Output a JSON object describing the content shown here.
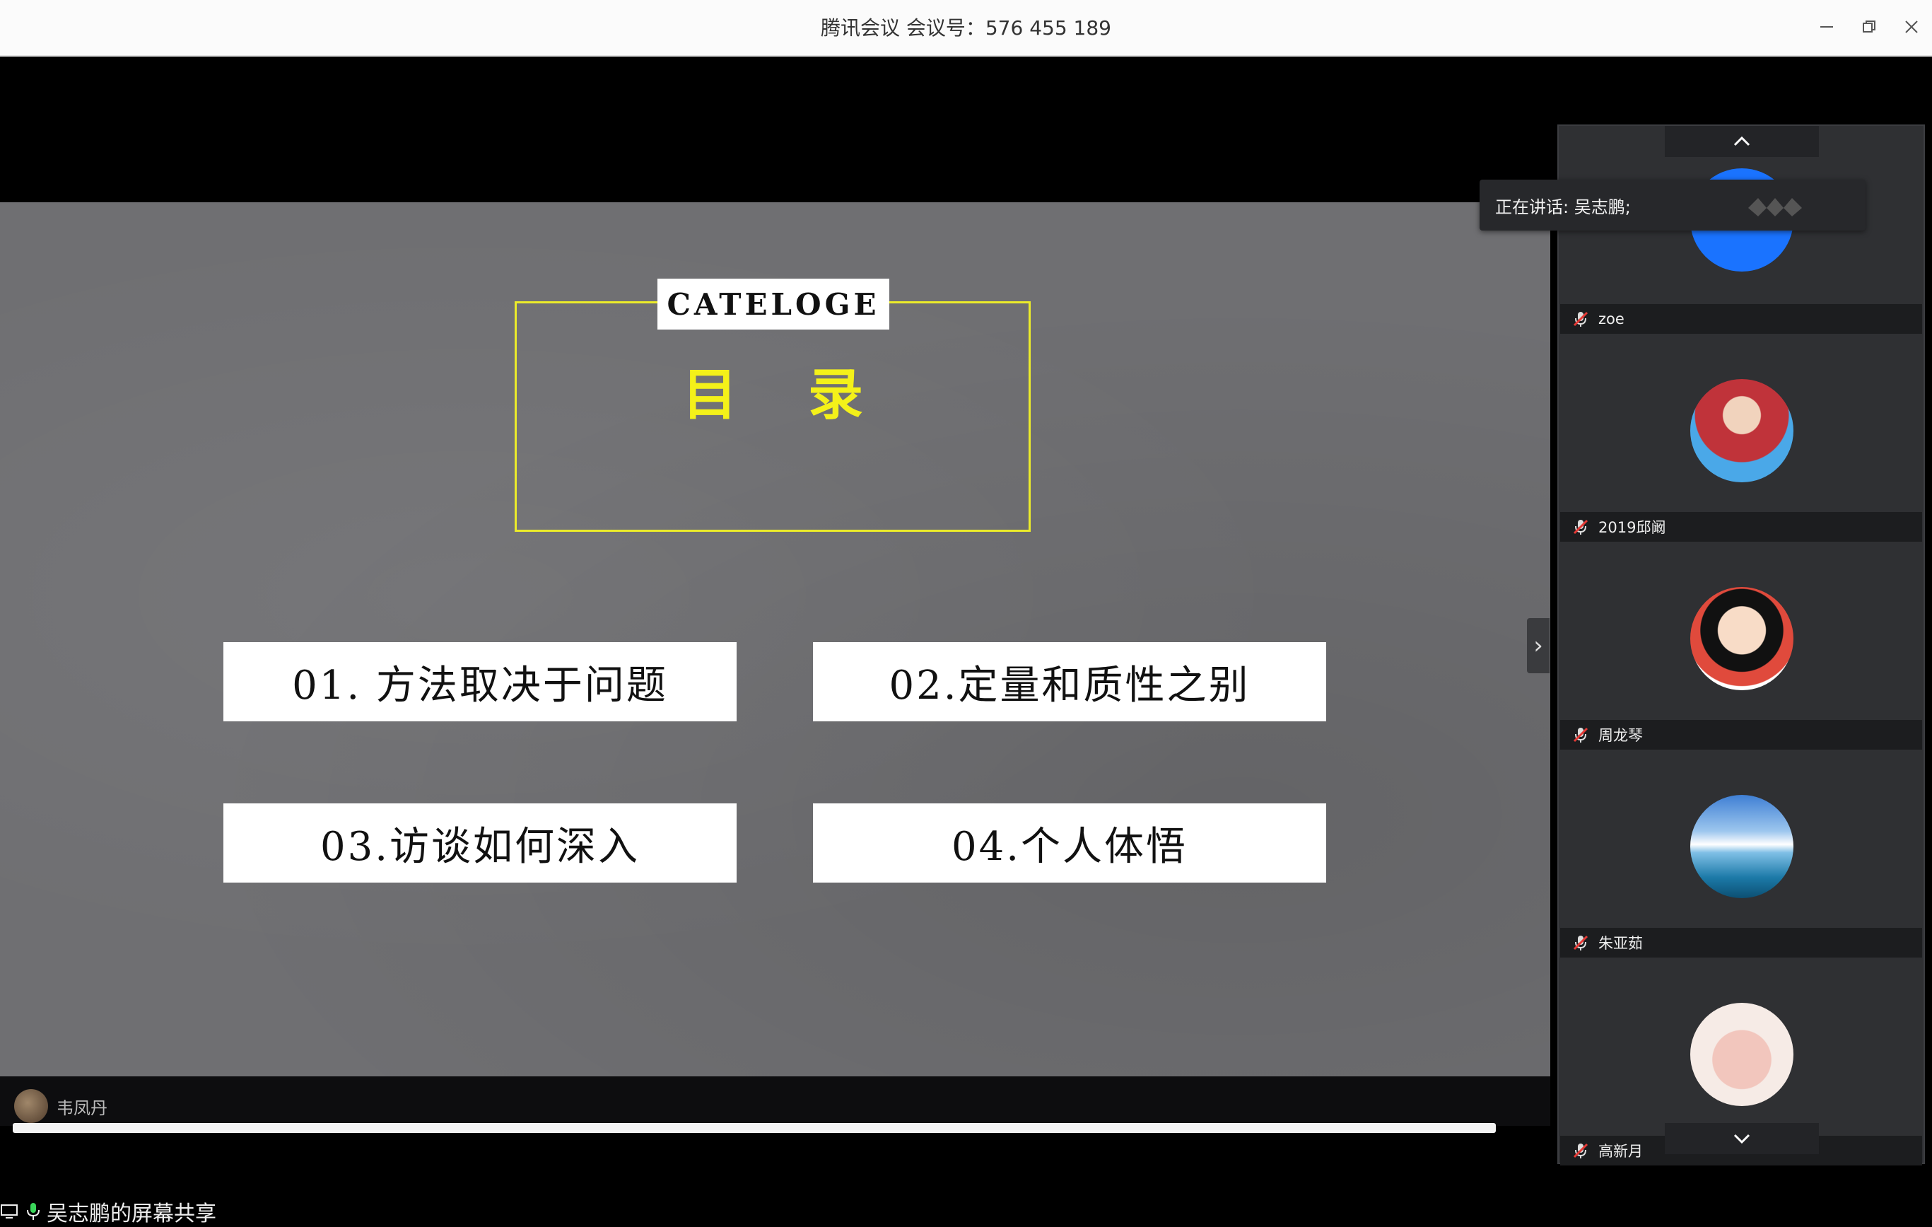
{
  "window": {
    "title": "腾讯会议 会议号：576 455 189",
    "minimize_icon": "minimize-icon",
    "restore_icon": "restore-icon",
    "close_icon": "close-icon"
  },
  "slide": {
    "heading_en": "CATELOGE",
    "heading_cn": "目录",
    "items": [
      "01. 方法取决于问题",
      "02.定量和质性之别",
      "03.访谈如何深入",
      "04.个人体悟"
    ],
    "colors": {
      "accent": "#f4f119",
      "background": "#6f6f72"
    }
  },
  "presenter_overlay": {
    "name": "韦凤丹"
  },
  "speaking_banner": {
    "label": "正在讲话: 吴志鹏;"
  },
  "participants": [
    {
      "name": "zoe"
    },
    {
      "name": "2019邱阚"
    },
    {
      "name": "周龙琴"
    },
    {
      "name": "朱亚茹"
    },
    {
      "name": "高新月"
    }
  ],
  "share": {
    "label": "吴志鹏的屏幕共享"
  }
}
